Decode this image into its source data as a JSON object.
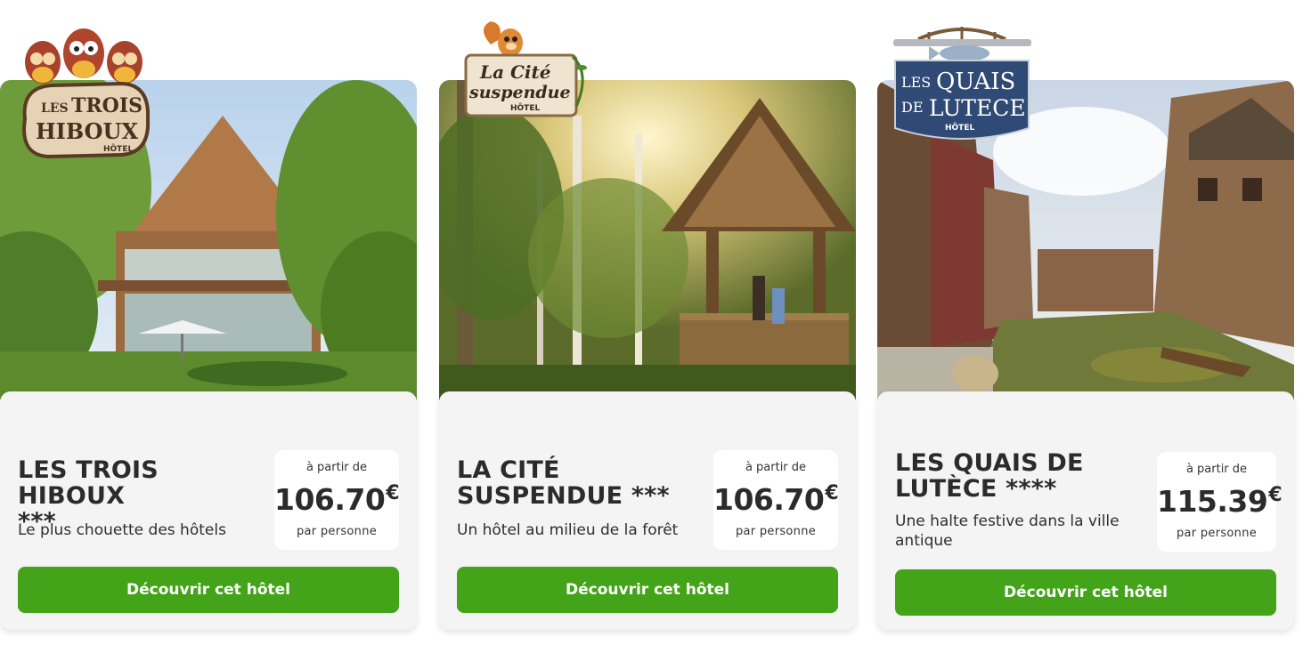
{
  "hotels": [
    {
      "name": "LES TROIS HIBOUX",
      "stars": "***",
      "tagline": "Le plus chouette des hôtels",
      "price_from": "à partir de",
      "price": "106.70",
      "currency": "€",
      "price_per": "par personne",
      "cta": "Découvrir cet hôtel",
      "logo": {
        "line1": "LES",
        "line2": "TROIS",
        "line3": "HIBOUX",
        "line4": "HÔTEL"
      }
    },
    {
      "name": "LA CITÉ SUSPENDUE",
      "stars": "***",
      "tagline": "Un hôtel au milieu de la forêt",
      "price_from": "à partir de",
      "price": "106.70",
      "currency": "€",
      "price_per": "par personne",
      "cta": "Découvrir cet hôtel",
      "logo": {
        "line1": "La Cité",
        "line2": "suspendue",
        "line3": "HÔTEL"
      }
    },
    {
      "name": "LES QUAIS DE LUTÈCE",
      "stars": "****",
      "tagline": "Une halte festive dans la ville antique",
      "price_from": "à partir de",
      "price": "115.39",
      "currency": "€",
      "price_per": "par personne",
      "cta": "Découvrir cet hôtel",
      "logo": {
        "line1": "LES",
        "line2": "QUAIS",
        "line3": "DE",
        "line4": "LUTECE",
        "line5": "HÔTEL"
      }
    }
  ],
  "colors": {
    "cta": "#43a319",
    "panel": "#f4f4f4",
    "text": "#2b2b2b"
  }
}
